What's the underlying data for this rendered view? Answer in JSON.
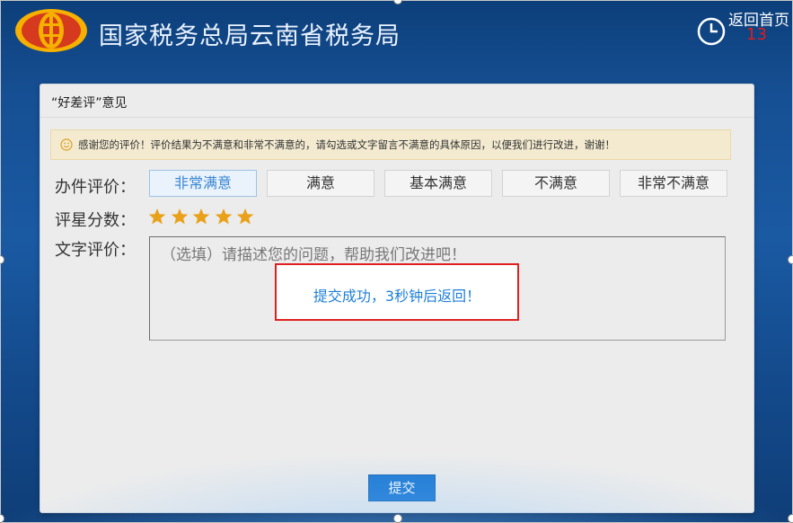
{
  "header": {
    "title": "国家税务总局云南省税务局",
    "home_label": "返回首页",
    "countdown": "13",
    "logo_icon": "tax-emblem-icon",
    "clock_icon": "clock-icon"
  },
  "dialog": {
    "title": "“好差评”意见",
    "notice_icon": "smile-icon",
    "notice": "感谢您的评价！评价结果为不满意和非常不满意的，请勾选或文字留言不满意的具体原因，以便我们进行改进，谢谢！",
    "rating_label": "办件评价：",
    "options": [
      "非常满意",
      "满意",
      "基本满意",
      "不满意",
      "非常不满意"
    ],
    "selected_option": "非常满意",
    "star_label": "评星分数：",
    "stars": 5,
    "stars_max": 5,
    "text_label": "文字评价：",
    "text_placeholder": "（选填）请描述您的问题，帮助我们改进吧！",
    "text_value": "",
    "toast": "提交成功，3秒钟后返回！",
    "submit_label": "提交"
  },
  "colors": {
    "background": "#1a5aa3",
    "accent": "#1f7ad3",
    "star": "#e9a11a",
    "countdown": "#e11b1b",
    "toast_border": "#e02020",
    "logo": "#d63a1e"
  }
}
